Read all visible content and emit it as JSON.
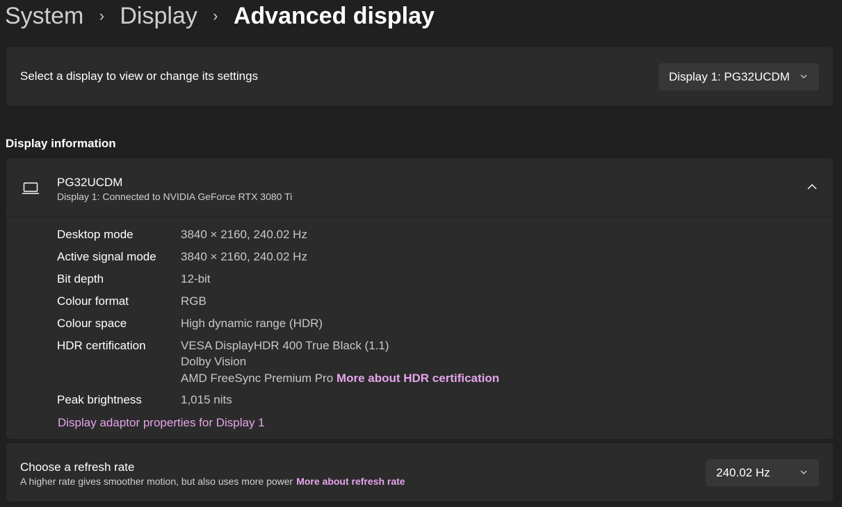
{
  "breadcrumb": {
    "items": [
      "System",
      "Display"
    ],
    "current": "Advanced display",
    "separator": "›"
  },
  "display_select": {
    "label": "Select a display to view or change its settings",
    "selected": "Display 1: PG32UCDM"
  },
  "display_info": {
    "section_title": "Display information",
    "monitor_name": "PG32UCDM",
    "monitor_description": "Display 1: Connected to NVIDIA GeForce RTX 3080 Ti",
    "specs": {
      "desktop_mode": {
        "label": "Desktop mode",
        "value": "3840 × 2160, 240.02 Hz"
      },
      "active_signal_mode": {
        "label": "Active signal mode",
        "value": "3840 × 2160, 240.02 Hz"
      },
      "bit_depth": {
        "label": "Bit depth",
        "value": "12-bit"
      },
      "colour_format": {
        "label": "Colour format",
        "value": "RGB"
      },
      "colour_space": {
        "label": "Colour space",
        "value": "High dynamic range (HDR)"
      },
      "hdr_certification": {
        "label": "HDR certification",
        "values": [
          "VESA DisplayHDR 400 True Black (1.1)",
          "Dolby Vision",
          "AMD FreeSync Premium Pro"
        ],
        "link": "More about HDR certification"
      },
      "peak_brightness": {
        "label": "Peak brightness",
        "value": "1,015 nits"
      }
    },
    "adapter_link": "Display adaptor properties for Display 1"
  },
  "refresh_rate": {
    "title": "Choose a refresh rate",
    "description": "A higher rate gives smoother motion, but also uses more power",
    "link": "More about refresh rate",
    "selected": "240.02 Hz"
  },
  "colors": {
    "background": "#202020",
    "card": "#2b2b2b",
    "accent_link": "#e6a5ea",
    "dropdown": "#373737"
  },
  "icons": [
    "chevron-right-icon",
    "chevron-down-icon",
    "laptop-icon",
    "chevron-up-icon"
  ]
}
